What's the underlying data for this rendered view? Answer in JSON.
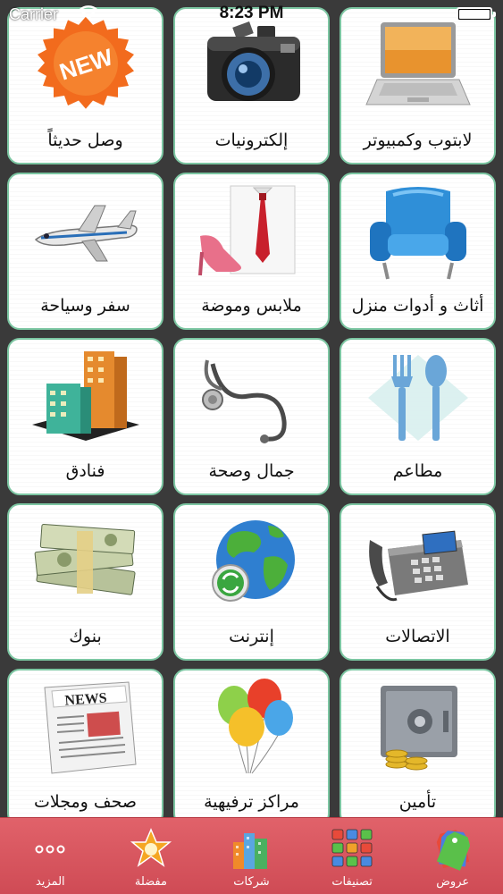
{
  "status_bar": {
    "carrier": "Carrier",
    "time": "8:23 PM"
  },
  "tiles": [
    {
      "label": "وصل حديثاً",
      "icon": "new-badge-icon"
    },
    {
      "label": "إلكترونيات",
      "icon": "camera-icon"
    },
    {
      "label": "لابتوب وكمبيوتر",
      "icon": "laptop-icon"
    },
    {
      "label": "سفر وسياحة",
      "icon": "airplane-icon"
    },
    {
      "label": "ملابس وموضة",
      "icon": "shirt-and-shoe-icon"
    },
    {
      "label": "أثاث و أدوات منزل",
      "icon": "armchair-icon"
    },
    {
      "label": "فنادق",
      "icon": "buildings-icon"
    },
    {
      "label": "جمال وصحة",
      "icon": "stethoscope-icon"
    },
    {
      "label": "مطاعم",
      "icon": "fork-spoon-icon"
    },
    {
      "label": "بنوك",
      "icon": "money-stack-icon"
    },
    {
      "label": "إنترنت",
      "icon": "globe-icon"
    },
    {
      "label": "الاتصالات",
      "icon": "telephone-icon"
    },
    {
      "label": "صحف ومجلات",
      "icon": "newspaper-icon"
    },
    {
      "label": "مراكز ترفيهية",
      "icon": "balloons-icon"
    },
    {
      "label": "تأمين",
      "icon": "safe-icon"
    }
  ],
  "new_badge_text": "NEW",
  "newspaper_text": "NEWS",
  "tabs": [
    {
      "label": "عروض",
      "icon": "tags-icon"
    },
    {
      "label": "تصنيفات",
      "icon": "categories-grid-icon"
    },
    {
      "label": "شركات",
      "icon": "companies-icon"
    },
    {
      "label": "مفضلة",
      "icon": "favorite-star-icon"
    },
    {
      "label": "المزيد",
      "icon": "more-dots-icon"
    }
  ],
  "colors": {
    "tile_border": "#7cc6a2",
    "tabbar": "#d9545e",
    "background": "#3a3a3a"
  }
}
